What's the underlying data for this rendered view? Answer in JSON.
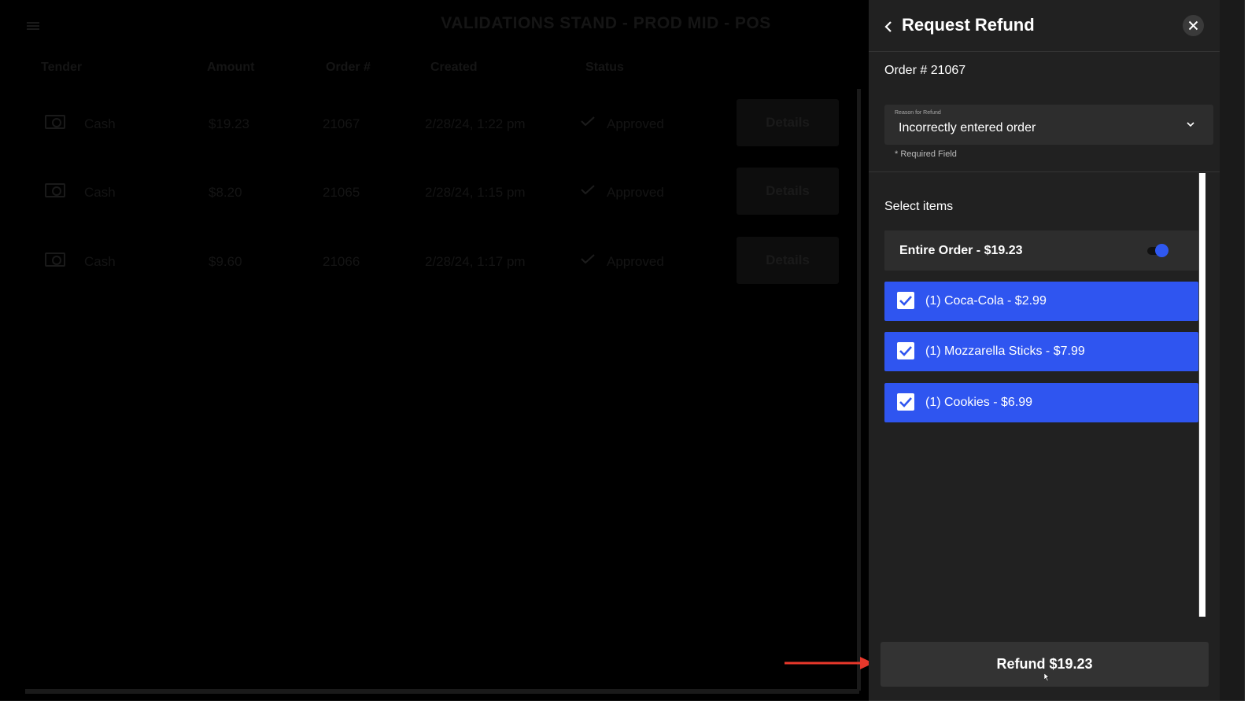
{
  "background": {
    "title": "VALIDATIONS STAND - PROD MID - POS",
    "columns": [
      "Tender",
      "Amount",
      "Order #",
      "Created",
      "Status"
    ],
    "rows": [
      {
        "tender": "Cash",
        "amount": "$19.23",
        "order": "21067",
        "created": "2/28/24, 1:22 pm",
        "status": "Approved",
        "action": "Details"
      },
      {
        "tender": "Cash",
        "amount": "$8.20",
        "order": "21065",
        "created": "2/28/24, 1:15 pm",
        "status": "Approved",
        "action": "Details"
      },
      {
        "tender": "Cash",
        "amount": "$9.60",
        "order": "21066",
        "created": "2/28/24, 1:17 pm",
        "status": "Approved",
        "action": "Details"
      }
    ]
  },
  "panel": {
    "title": "Request Refund",
    "order_number": "Order # 21067",
    "reason": {
      "label": "Reason for Refund",
      "value": "Incorrectly entered order",
      "helper": "* Required Field"
    },
    "select_label": "Select items",
    "entire_order": {
      "label": "Entire Order - $19.23",
      "on": true
    },
    "items": [
      {
        "label": "(1) Coca-Cola - $2.99",
        "checked": true
      },
      {
        "label": "(1) Mozzarella Sticks - $7.99",
        "checked": true
      },
      {
        "label": "(1) Cookies - $6.99",
        "checked": true
      }
    ],
    "refund_button": "Refund $19.23"
  },
  "colors": {
    "accent_blue": "#2f55f0",
    "panel_bg": "#212121",
    "annotation_arrow": "#e8382b"
  },
  "icons": [
    "menu-icon",
    "cash-icon",
    "check-icon",
    "back-chevron-icon",
    "close-icon",
    "chevron-down-icon",
    "checkbox-icon",
    "arrow-annotation-icon",
    "mouse-cursor-icon"
  ]
}
